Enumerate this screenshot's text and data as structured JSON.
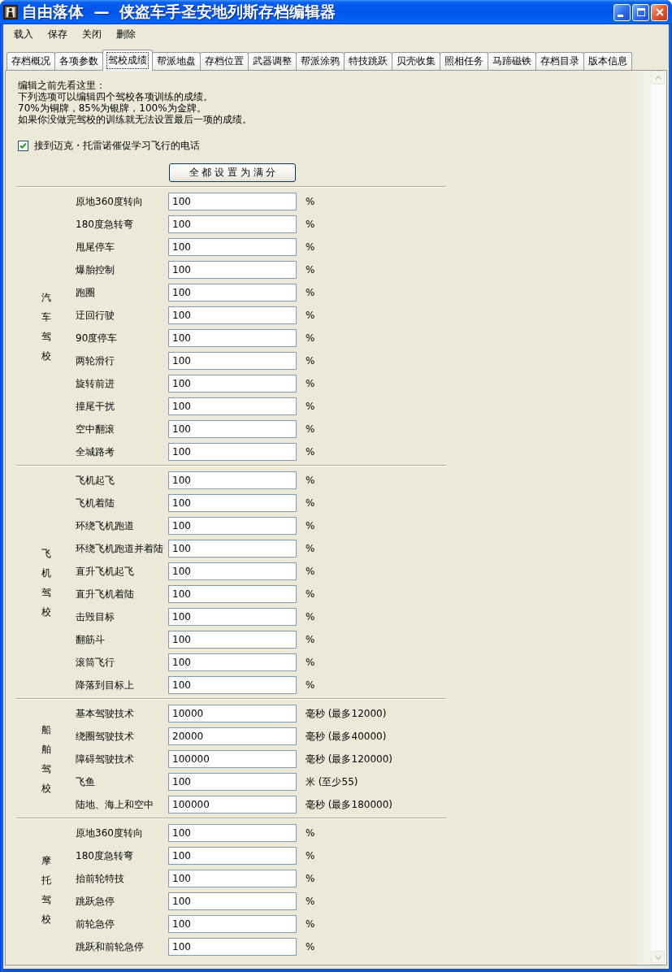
{
  "window": {
    "title": "自由落体 — 侠盗车手圣安地列斯存档编辑器"
  },
  "menu": [
    {
      "label": "载入"
    },
    {
      "label": "保存"
    },
    {
      "label": "关闭"
    },
    {
      "label": "删除"
    }
  ],
  "tabs": [
    {
      "label": "存档概况",
      "selected": false
    },
    {
      "label": "各项参数",
      "selected": false
    },
    {
      "label": "驾校成绩",
      "selected": true
    },
    {
      "label": "帮派地盘",
      "selected": false
    },
    {
      "label": "存档位置",
      "selected": false
    },
    {
      "label": "武器调整",
      "selected": false
    },
    {
      "label": "帮派涂鸦",
      "selected": false
    },
    {
      "label": "特技跳跃",
      "selected": false
    },
    {
      "label": "贝壳收集",
      "selected": false
    },
    {
      "label": "照相任务",
      "selected": false
    },
    {
      "label": "马蹄磁铁",
      "selected": false
    },
    {
      "label": "存档目录",
      "selected": false
    },
    {
      "label": "版本信息",
      "selected": false
    }
  ],
  "notes": [
    "编辑之前先看这里：",
    "下列选项可以编辑四个驾校各项训练的成绩。",
    "70%为铜牌，85%为银牌，100%为金牌。",
    "如果你没做完驾校的训练就无法设置最后一项的成绩。"
  ],
  "phone_call": {
    "label": "接到迈克・托雷诺催促学习飞行的电话",
    "checked": true
  },
  "set_all_button": {
    "label": "全 都 设 置 为 满 分"
  },
  "schools": [
    {
      "label": "汽车驾校",
      "rows": [
        {
          "label": "原地360度转向",
          "value": "100",
          "unit": "%"
        },
        {
          "label": "180度急转弯",
          "value": "100",
          "unit": "%"
        },
        {
          "label": "甩尾停车",
          "value": "100",
          "unit": "%"
        },
        {
          "label": "爆胎控制",
          "value": "100",
          "unit": "%"
        },
        {
          "label": "跑圈",
          "value": "100",
          "unit": "%"
        },
        {
          "label": "迂回行驶",
          "value": "100",
          "unit": "%"
        },
        {
          "label": "90度停车",
          "value": "100",
          "unit": "%"
        },
        {
          "label": "两轮滑行",
          "value": "100",
          "unit": "%"
        },
        {
          "label": "旋转前进",
          "value": "100",
          "unit": "%"
        },
        {
          "label": "撞尾干扰",
          "value": "100",
          "unit": "%"
        },
        {
          "label": "空中翻滚",
          "value": "100",
          "unit": "%"
        },
        {
          "label": "全城路考",
          "value": "100",
          "unit": "%"
        }
      ]
    },
    {
      "label": "飞机驾校",
      "rows": [
        {
          "label": "飞机起飞",
          "value": "100",
          "unit": "%"
        },
        {
          "label": "飞机着陆",
          "value": "100",
          "unit": "%"
        },
        {
          "label": "环绕飞机跑道",
          "value": "100",
          "unit": "%"
        },
        {
          "label": "环绕飞机跑道并着陆",
          "value": "100",
          "unit": "%"
        },
        {
          "label": "直升飞机起飞",
          "value": "100",
          "unit": "%"
        },
        {
          "label": "直升飞机着陆",
          "value": "100",
          "unit": "%"
        },
        {
          "label": "击毁目标",
          "value": "100",
          "unit": "%"
        },
        {
          "label": "翻筋斗",
          "value": "100",
          "unit": "%"
        },
        {
          "label": "滚筒飞行",
          "value": "100",
          "unit": "%"
        },
        {
          "label": "降落到目标上",
          "value": "100",
          "unit": "%"
        }
      ]
    },
    {
      "label": "船舶驾校",
      "rows": [
        {
          "label": "基本驾驶技术",
          "value": "10000",
          "unit": "毫秒 (最多12000)"
        },
        {
          "label": "绕圈驾驶技术",
          "value": "20000",
          "unit": "毫秒 (最多40000)"
        },
        {
          "label": "障碍驾驶技术",
          "value": "100000",
          "unit": "毫秒 (最多120000)"
        },
        {
          "label": "飞鱼",
          "value": "100",
          "unit": "米 (至少55)"
        },
        {
          "label": "陆地、海上和空中",
          "value": "100000",
          "unit": "毫秒 (最多180000)"
        }
      ]
    },
    {
      "label": "摩托驾校",
      "rows": [
        {
          "label": "原地360度转向",
          "value": "100",
          "unit": "%"
        },
        {
          "label": "180度急转弯",
          "value": "100",
          "unit": "%"
        },
        {
          "label": "抬前轮特技",
          "value": "100",
          "unit": "%"
        },
        {
          "label": "跳跃急停",
          "value": "100",
          "unit": "%"
        },
        {
          "label": "前轮急停",
          "value": "100",
          "unit": "%"
        },
        {
          "label": "跳跃和前轮急停",
          "value": "100",
          "unit": "%"
        }
      ]
    }
  ]
}
